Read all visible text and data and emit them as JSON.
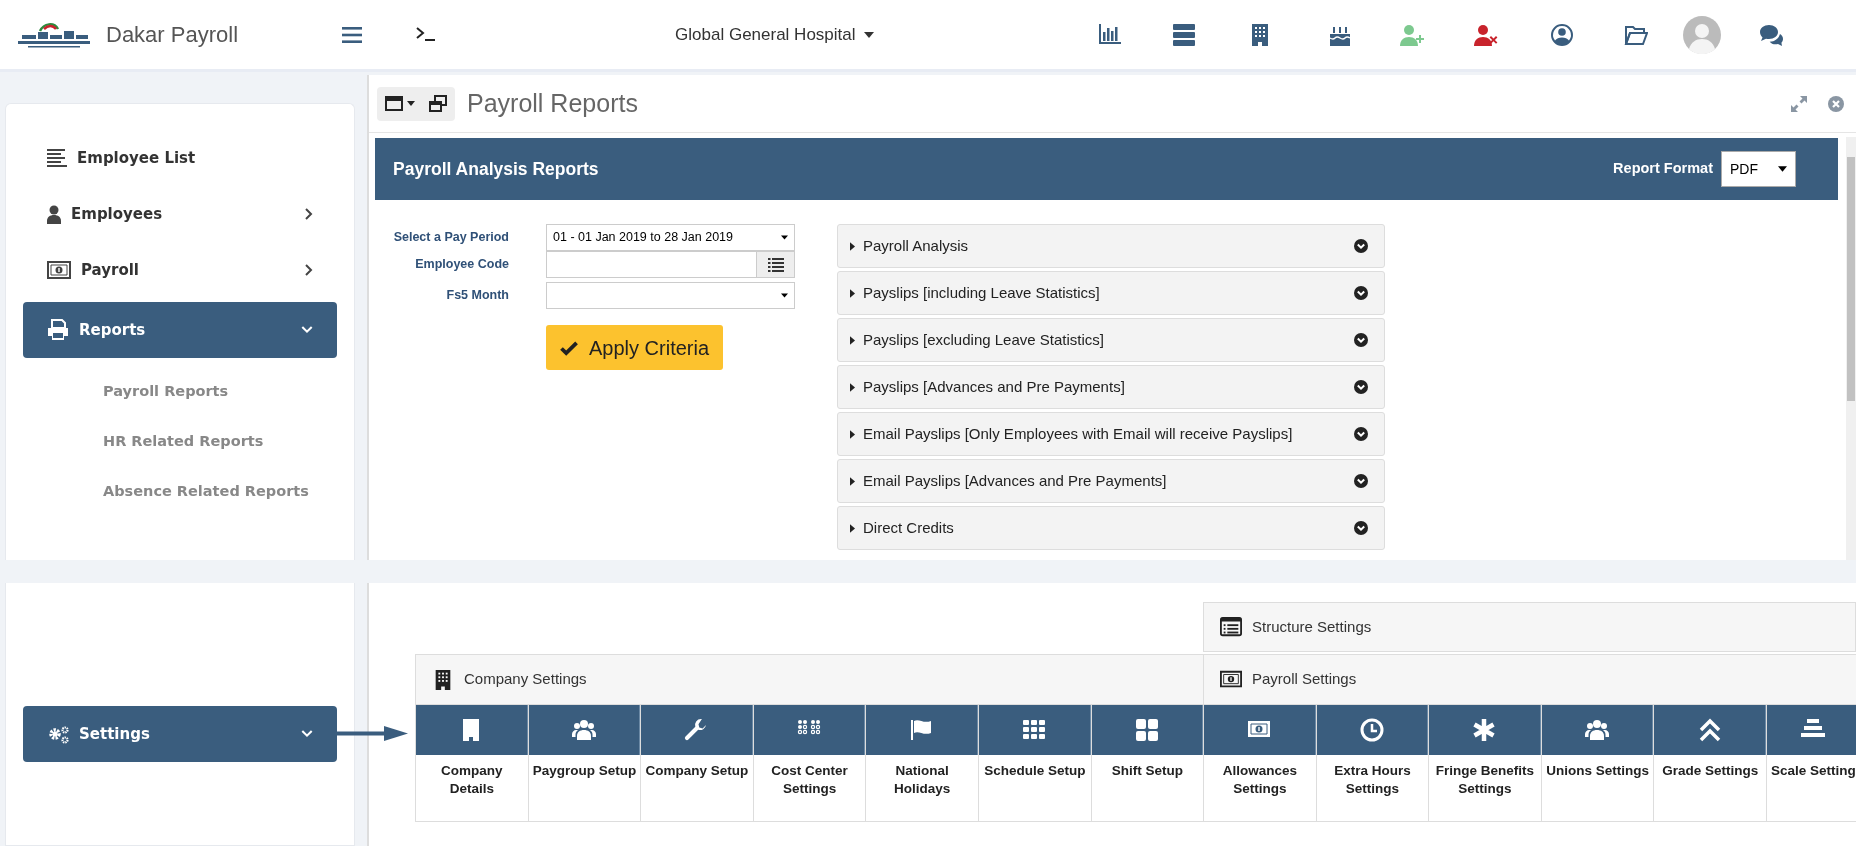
{
  "app": {
    "title": "Dakar Payroll",
    "organization": "Global General Hospital"
  },
  "sidebar": {
    "items": [
      {
        "label": "Employee List",
        "kind": "link",
        "selected": false
      },
      {
        "label": "Employees",
        "kind": "group",
        "selected": false,
        "expanded": false
      },
      {
        "label": "Payroll",
        "kind": "group",
        "selected": false,
        "expanded": false
      },
      {
        "label": "Reports",
        "kind": "group",
        "selected": true,
        "expanded": true,
        "children": [
          {
            "label": "Payroll Reports"
          },
          {
            "label": "HR Related Reports"
          },
          {
            "label": "Absence Related Reports"
          }
        ]
      }
    ]
  },
  "panel": {
    "title": "Payroll Reports",
    "header": "Payroll Analysis Reports",
    "report_format": {
      "label": "Report Format",
      "value": "PDF"
    },
    "fields": [
      {
        "label": "Select a Pay Period",
        "kind": "select",
        "value": "01 - 01 Jan 2019  to  28 Jan 2019"
      },
      {
        "label": "Employee Code",
        "kind": "lookup"
      },
      {
        "label": "Fs5 Month",
        "kind": "select"
      }
    ],
    "apply_button": "Apply Criteria",
    "reports": [
      {
        "label": "Payroll Analysis",
        "expanded": false
      },
      {
        "label": "Payslips [including Leave Statistics]",
        "expanded": false
      },
      {
        "label": "Payslips [excluding Leave Statistics]",
        "expanded": false
      },
      {
        "label": "Payslips [Advances and Pre Payments]",
        "expanded": false
      },
      {
        "label": "Email Payslips [Only Employees with Email will receive Payslips]",
        "expanded": false
      },
      {
        "label": "Email Payslips [Advances and Pre Payments]",
        "expanded": false
      },
      {
        "label": "Direct Credits",
        "expanded": false
      }
    ]
  },
  "settings": {
    "sidebar_item": {
      "label": "Settings",
      "selected": true,
      "expanded": true
    },
    "company_settings": {
      "title": "Company Settings",
      "tiles": [
        "Company Details",
        "Paygroup Setup",
        "Company Setup",
        "Cost Center Settings",
        "National Holidays",
        "Schedule Setup",
        "Shift Setup"
      ]
    },
    "structure_settings": {
      "title": "Structure Settings"
    },
    "payroll_settings": {
      "title": "Payroll Settings",
      "tiles": [
        "Allowances Settings",
        "Extra Hours Settings",
        "Fringe Benefits Settings",
        "Unions Settings",
        "Grade Settings",
        "Scale Setting"
      ]
    }
  }
}
